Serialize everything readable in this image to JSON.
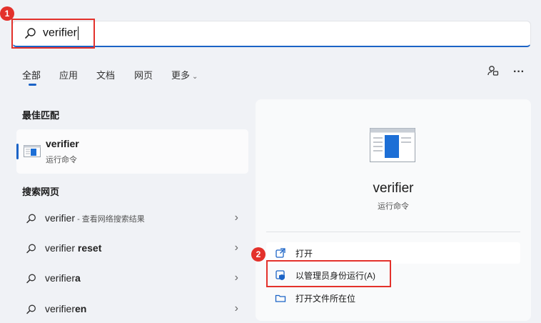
{
  "search": {
    "query": "verifier"
  },
  "callouts": {
    "one": "1",
    "two": "2"
  },
  "tabs": [
    {
      "label": "全部",
      "active": true
    },
    {
      "label": "应用"
    },
    {
      "label": "文档"
    },
    {
      "label": "网页"
    },
    {
      "label": "更多"
    }
  ],
  "toolbar": {
    "more_glyph": "···"
  },
  "best_match": {
    "heading": "最佳匹配",
    "title": "verifier",
    "subtitle": "运行命令"
  },
  "web_search": {
    "heading": "搜索网页",
    "items": [
      {
        "prefix": "verifier",
        "bold": "",
        "extra": " - 查看网络搜索结果"
      },
      {
        "prefix": "verifier ",
        "bold": "reset",
        "extra": ""
      },
      {
        "prefix": "verifier",
        "bold": "a",
        "extra": ""
      },
      {
        "prefix": "verifier",
        "bold": "en",
        "extra": ""
      }
    ]
  },
  "preview": {
    "title": "verifier",
    "subtitle": "运行命令",
    "actions": [
      {
        "label": "打开"
      },
      {
        "label": "以管理员身份运行(A)"
      },
      {
        "label": "打开文件所在位"
      }
    ]
  },
  "colors": {
    "accent": "#1b63c6",
    "callout": "#e3312b",
    "background": "#f0f2f6"
  }
}
